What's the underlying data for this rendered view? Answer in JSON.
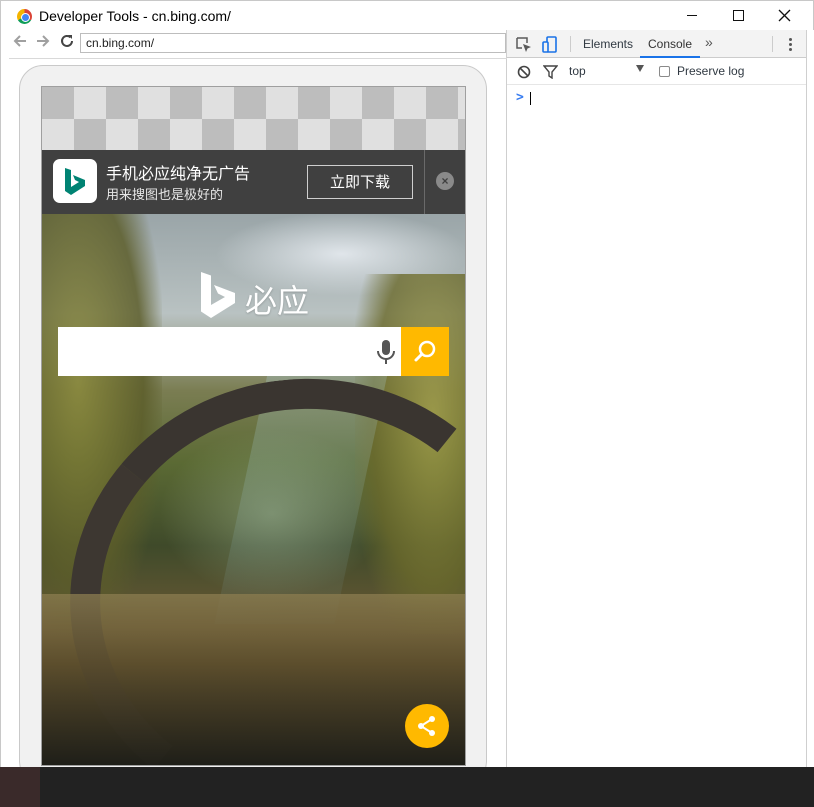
{
  "window": {
    "title": "Developer Tools - cn.bing.com/"
  },
  "browser": {
    "address": "cn.bing.com/"
  },
  "ad_banner": {
    "title": "手机必应纯净无广告",
    "subtitle": "用来搜图也是极好的",
    "download_label": "立即下载",
    "close_glyph": "×"
  },
  "bing_page": {
    "logo_text": "必应",
    "search_placeholder": "",
    "accent_color": "#ffb900"
  },
  "devtools": {
    "tabs": [
      {
        "label": "Elements",
        "active": false
      },
      {
        "label": "Console",
        "active": true
      }
    ],
    "more_glyph": "»",
    "context": "top",
    "preserve_log_label": "Preserve log",
    "preserve_log_checked": false,
    "prompt_glyph": ">",
    "accent_color": "#1a73e8"
  },
  "icons": {
    "back": "arrow-left-icon",
    "forward": "arrow-right-icon",
    "reload": "reload-icon",
    "inspect": "inspect-element-icon",
    "device": "device-toolbar-icon",
    "clear": "clear-console-icon",
    "filter": "filter-icon",
    "mic": "microphone-icon",
    "search": "search-icon",
    "share": "share-icon"
  }
}
